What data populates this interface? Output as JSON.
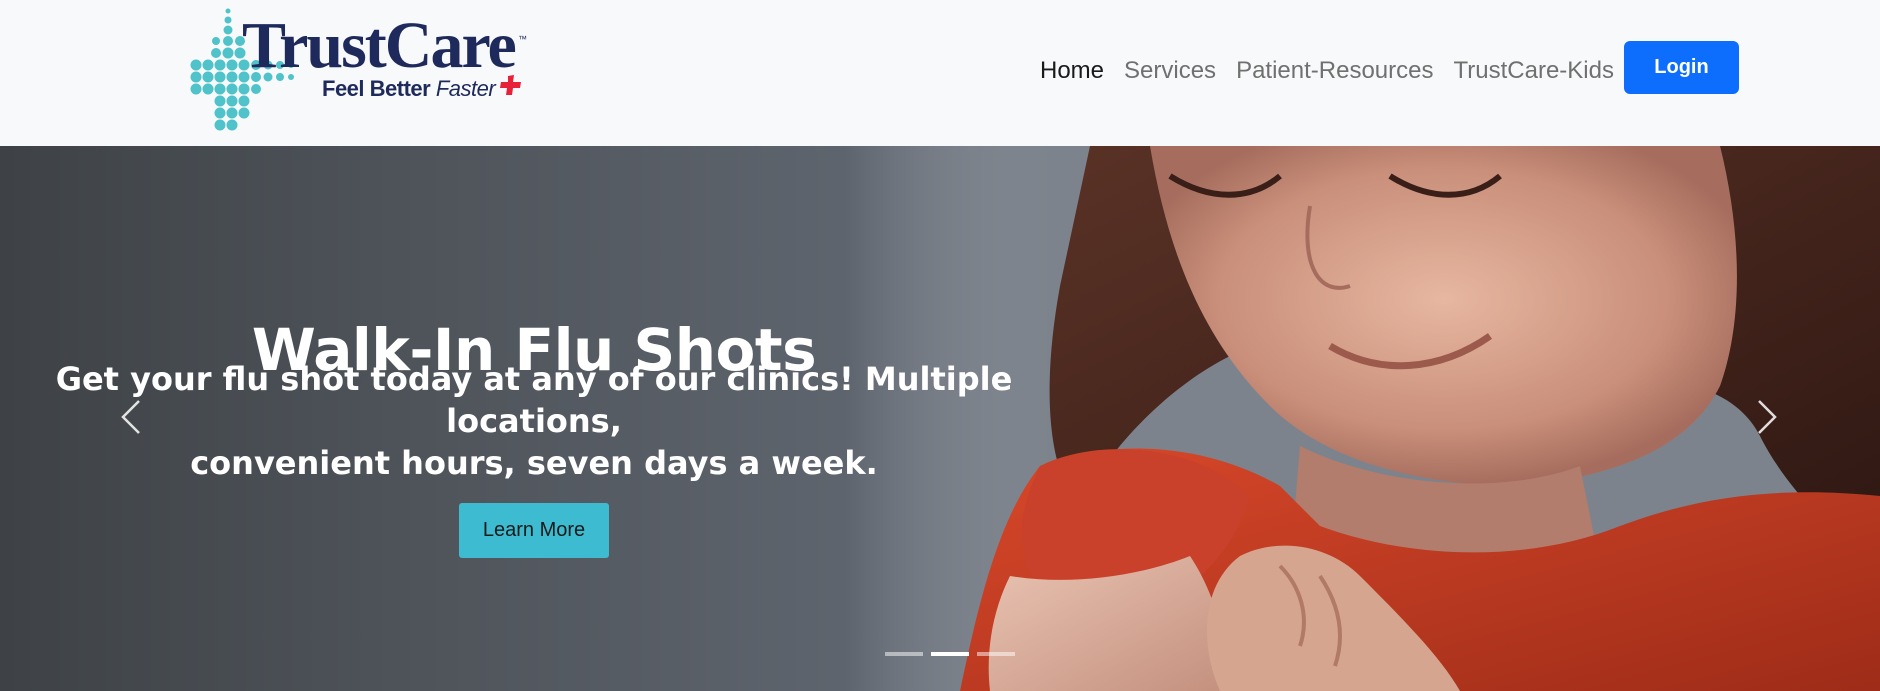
{
  "brand": {
    "name": "TrustCare",
    "trademark": "™",
    "tagline_bold": "Feel Better",
    "tagline_italic": "Faster",
    "colors": {
      "navy": "#1f2a5c",
      "teal": "#4fc3c9",
      "red": "#e8213a"
    }
  },
  "nav": {
    "links": [
      {
        "label": "Home",
        "active": true
      },
      {
        "label": "Services",
        "active": false
      },
      {
        "label": "Patient-Resources",
        "active": false
      },
      {
        "label": "TrustCare-Kids",
        "active": false
      }
    ],
    "login_label": "Login",
    "login_color": "#0d6efd"
  },
  "hero": {
    "title": "Walk-In Flu Shots",
    "subtitle_line1": "Get your flu shot today at any of our clinics! Multiple locations,",
    "subtitle_line2": "convenient hours, seven days a week.",
    "cta_label": "Learn More",
    "cta_color": "#3dbbd0",
    "prev_icon": "chevron-left-icon",
    "next_icon": "chevron-right-icon",
    "slides_count": 3,
    "active_slide": 2
  }
}
